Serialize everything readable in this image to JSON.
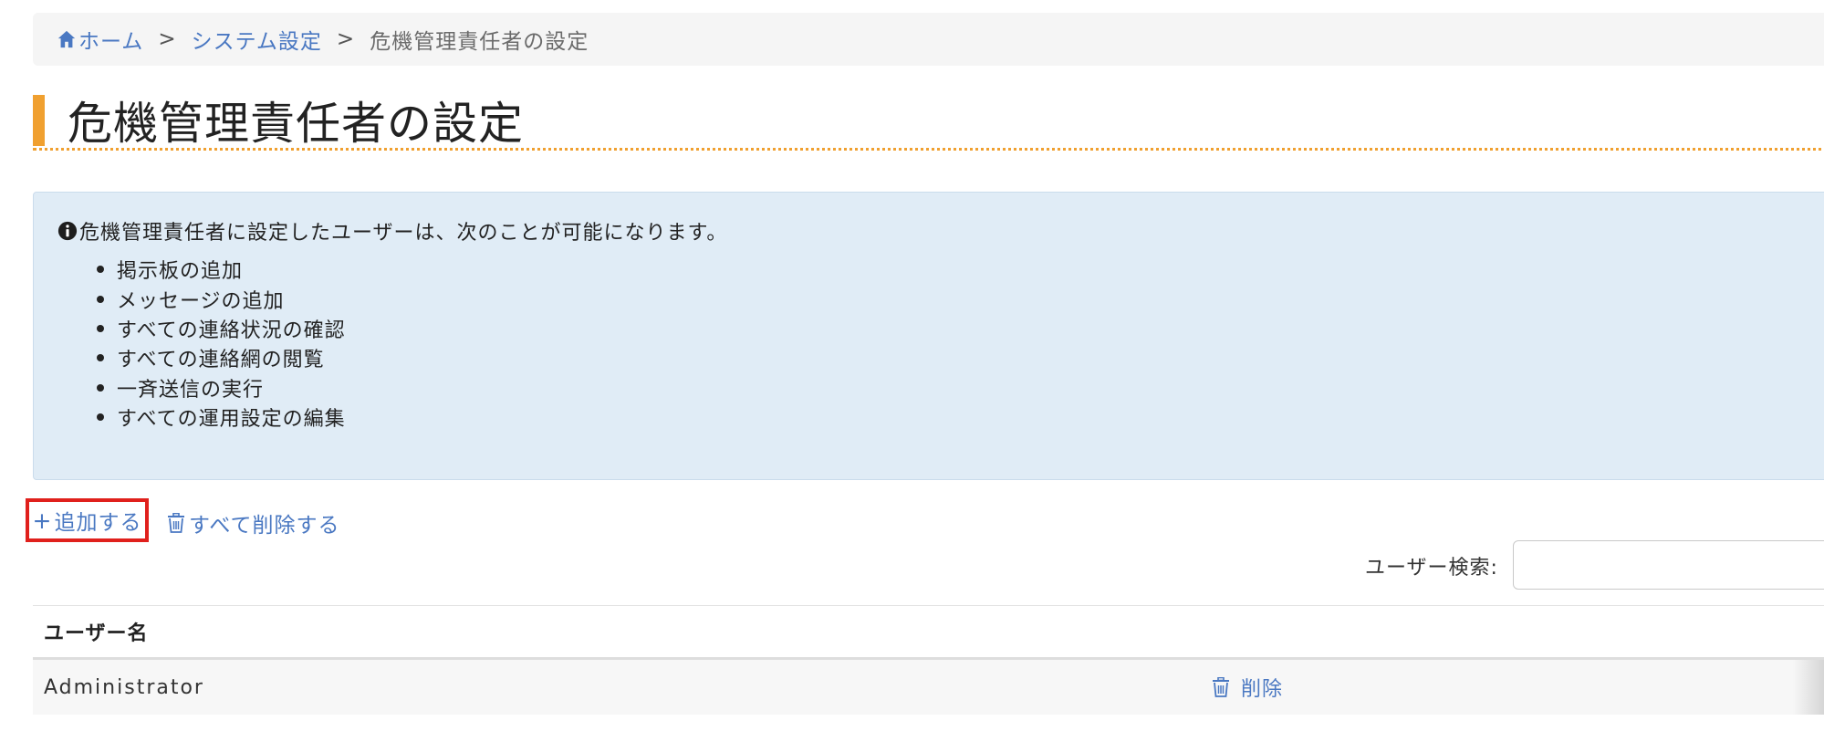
{
  "breadcrumb": {
    "home_label": "ホーム",
    "separator": ">",
    "settings_label": "システム設定",
    "current_label": "危機管理責任者の設定"
  },
  "page": {
    "title": "危機管理責任者の設定"
  },
  "info": {
    "heading": "危機管理責任者に設定したユーザーは、次のことが可能になります。",
    "items": [
      "掲示板の追加",
      "メッセージの追加",
      "すべての連絡状況の確認",
      "すべての連絡網の閲覧",
      "一斉送信の実行",
      "すべての運用設定の編集"
    ]
  },
  "actions": {
    "add_icon": "+",
    "add_label": "追加する",
    "delete_all_label": "すべて削除する"
  },
  "search": {
    "label": "ユーザー検索:",
    "value": "",
    "placeholder": ""
  },
  "table": {
    "column_username": "ユーザー名",
    "rows": [
      {
        "username": "Administrator",
        "delete_label": "削除"
      }
    ]
  },
  "colors": {
    "link": "#4a78c2",
    "accent": "#f0a030",
    "info_bg": "#e0ecf6",
    "highlight": "#e0201c"
  },
  "icons": {
    "home": "home-icon",
    "info": "info-circle-icon",
    "add": "plus-icon",
    "trash": "trash-icon"
  }
}
